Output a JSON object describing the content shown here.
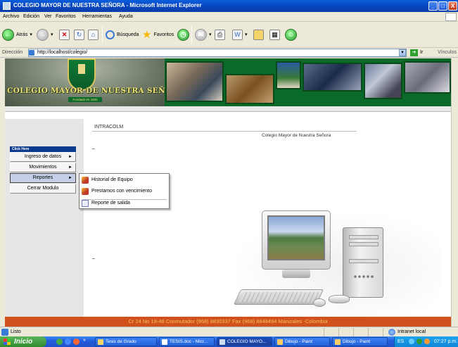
{
  "window": {
    "title": "COLEGIO MAYOR DE NUESTRA SEÑORA - Microsoft Internet Explorer",
    "buttons": [
      "_",
      "□",
      "X"
    ]
  },
  "menubar": [
    "Archivo",
    "Edición",
    "Ver",
    "Favoritos",
    "Herramientas",
    "Ayuda"
  ],
  "toolbar": {
    "back_label": "Atrás",
    "search_label": "Búsqueda",
    "favorites_label": "Favoritos"
  },
  "address": {
    "label": "Dirección",
    "url": "http://localhost/colegio/",
    "go_label": "Ir",
    "links_label": "Vínculos"
  },
  "page": {
    "banner": {
      "school_name": "COLEGIO MAYOR DE NUESTRA SEÑORA",
      "founded": "Fundado en 1834"
    },
    "intracolm": "INTRACOLM",
    "school_right": "Colegio Mayor de Nuestra Señora",
    "menu": {
      "title": "Click Here",
      "items": [
        {
          "label": "Ingreso de datos",
          "arrow": "►"
        },
        {
          "label": "Movimientos",
          "arrow": "►"
        },
        {
          "label": "Reportes",
          "arrow": "►"
        },
        {
          "label": "Cerrar Modulo",
          "arrow": ""
        }
      ],
      "submenu": [
        "Historial de Equipo",
        "Prestamos con vencimiento",
        "Reporte de salida"
      ]
    },
    "footer": "Cr 24 No 18-46 Conmutador (968) 8830337 Fax (968) 8848494 Manizales -Colombia"
  },
  "statusbar": {
    "status": "Listo",
    "zone": "Intranet local"
  },
  "taskbar": {
    "start_label": "Inicio",
    "tasks": [
      "Tesis de Grado",
      "TESIS.doc - Micr...",
      "COLEGIO MAYO...",
      "Dibujo - Paint",
      "Dibujo - Paint"
    ],
    "lang": "ES",
    "clock": "07:27 p.m."
  }
}
